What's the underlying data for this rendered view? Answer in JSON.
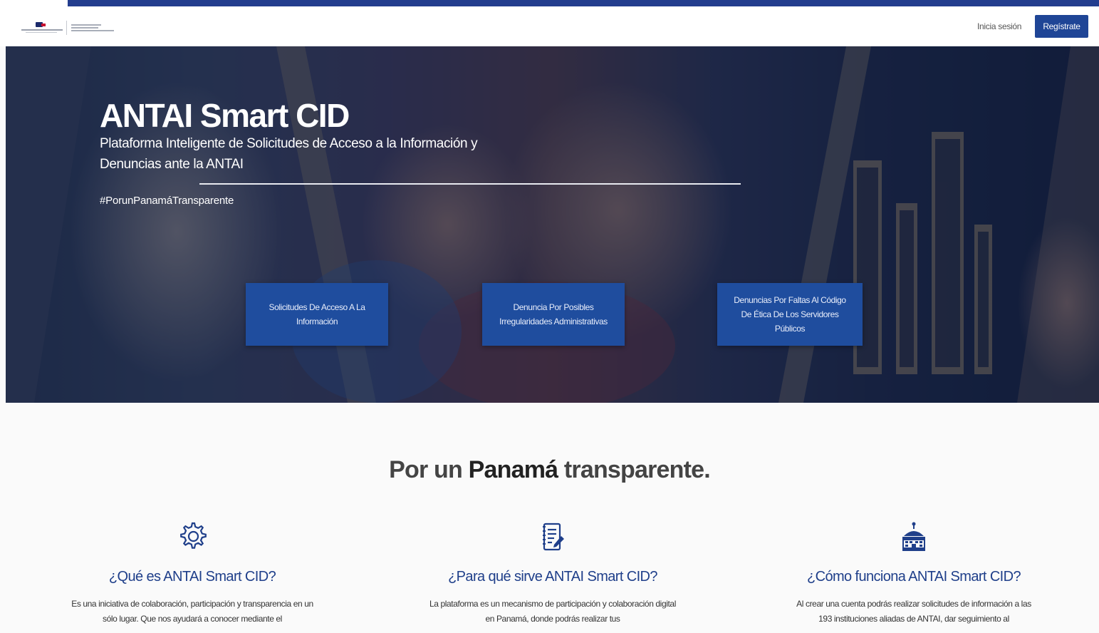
{
  "header": {
    "login_label": "Inicia sesión",
    "register_label": "Regístrate"
  },
  "hero": {
    "title": "ANTAI Smart CID",
    "subtitle": "Plataforma Inteligente de Solicitudes de Acceso a la Información y Denuncias ante la ANTAI",
    "hashtag": "#PorunPanamáTransparente",
    "buttons": [
      {
        "label": "Solicitudes De Acceso A La Información"
      },
      {
        "label": "Denuncia Por Posibles Irregularidades Administrativas"
      },
      {
        "label": "Denuncias Por Faltas Al Código De Ética De Los Servidores Públicos"
      }
    ]
  },
  "section": {
    "heading_pre": "Por un ",
    "heading_bold": "Panamá",
    "heading_post": " transparente.",
    "features": [
      {
        "icon": "gear-icon",
        "title": "¿Qué es ANTAI Smart CID?",
        "text": "Es una iniciativa de colaboración, participación y transparencia en un sólo lugar. Que nos ayudará a conocer mediante el"
      },
      {
        "icon": "notepad-icon",
        "title": "¿Para qué sirve ANTAI Smart CID?",
        "text": "La plataforma es un mecanismo de participación y colaboración digital en Panamá, donde podrás realizar tus"
      },
      {
        "icon": "government-building-icon",
        "title": "¿Cómo funciona ANTAI Smart CID?",
        "text": "Al crear una cuenta podrás realizar solicitudes de información a las 193 instituciones aliadas de ANTAI, dar seguimiento al"
      }
    ]
  },
  "colors": {
    "brand_blue": "#233d8e",
    "button_blue": "#1f4596",
    "feature_title": "#1f3f8a"
  }
}
